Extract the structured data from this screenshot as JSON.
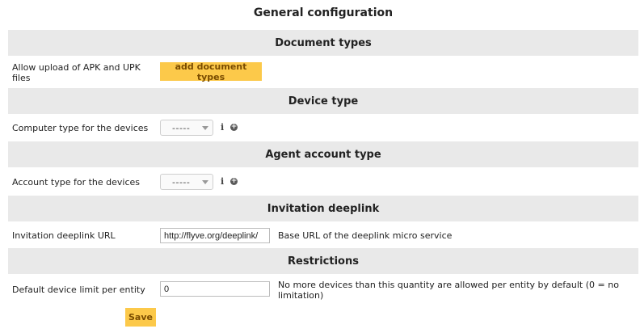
{
  "page_title": "General configuration",
  "sections": {
    "document_types": {
      "header": "Document types",
      "label": "Allow upload of APK and UPK files",
      "button": "add document types"
    },
    "device_type": {
      "header": "Device type",
      "label": "Computer type for the devices",
      "select_value": "-----"
    },
    "agent_account_type": {
      "header": "Agent account type",
      "label": "Account type for the devices",
      "select_value": "-----"
    },
    "invitation_deeplink": {
      "header": "Invitation deeplink",
      "label": "Invitation deeplink URL",
      "input_value": "http://flyve.org/deeplink/",
      "description": "Base URL of the deeplink micro service"
    },
    "restrictions": {
      "header": "Restrictions",
      "label": "Default device limit per entity",
      "input_value": "0",
      "description": "No more devices than this quantity are allowed per entity by default (0 = no limitation)"
    }
  },
  "save_label": "Save",
  "icons": {
    "info": "i",
    "add": "+"
  },
  "colors": {
    "header_bg": "#e9e9e9",
    "button_bg": "#fcc94a",
    "button_text": "#7a4c00"
  }
}
